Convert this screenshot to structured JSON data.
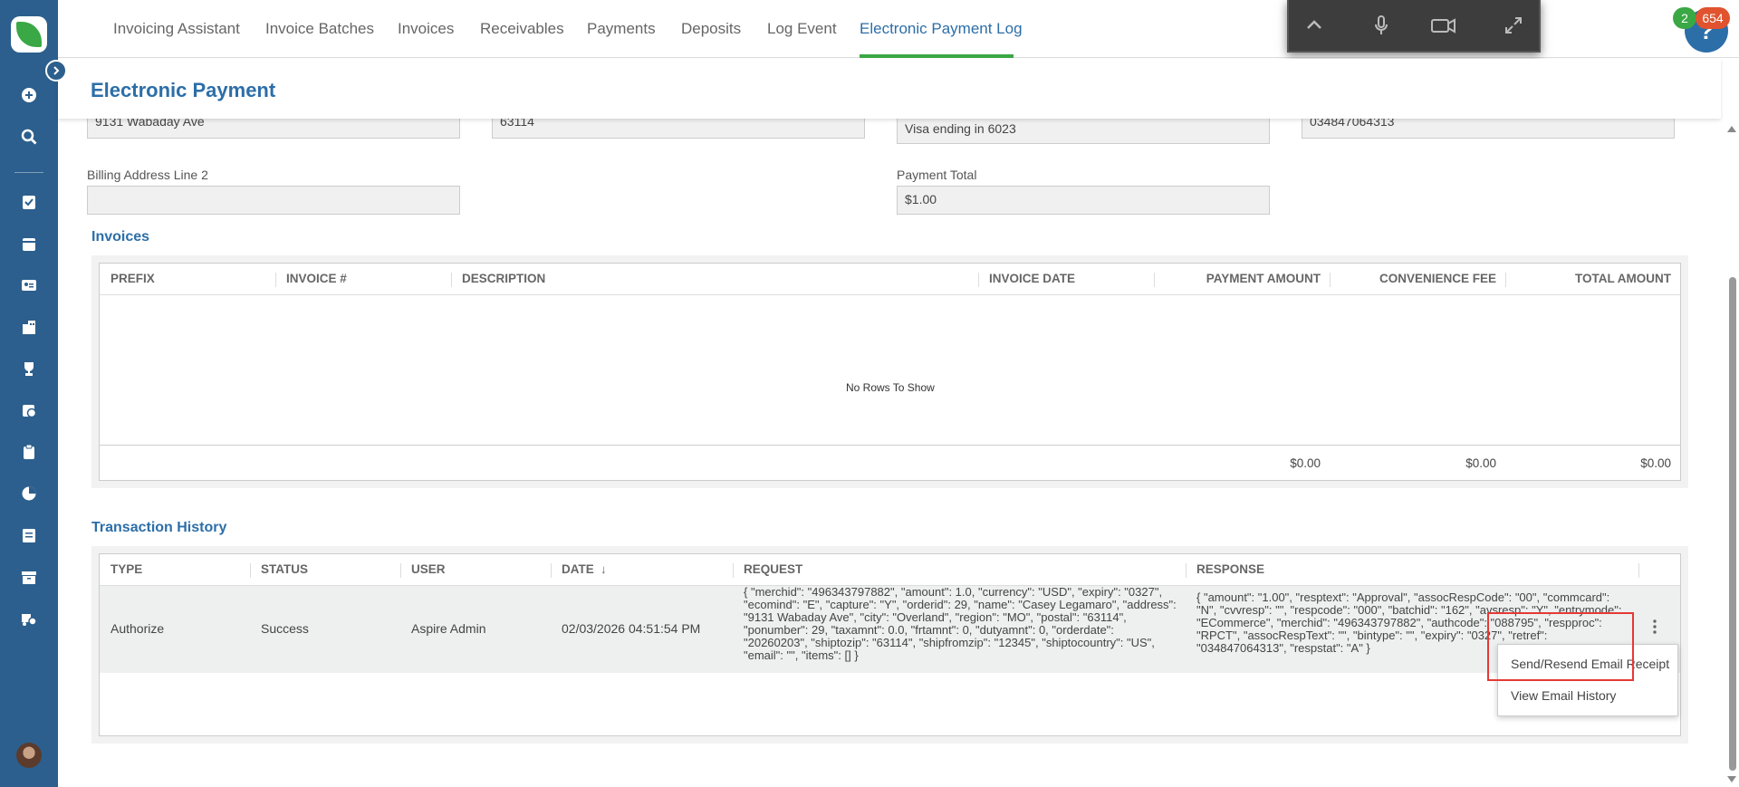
{
  "nav": {
    "items": [
      {
        "label": "Invoicing Assistant"
      },
      {
        "label": "Invoice Batches"
      },
      {
        "label": "Invoices"
      },
      {
        "label": "Receivables"
      },
      {
        "label": "Payments"
      },
      {
        "label": "Deposits"
      },
      {
        "label": "Log Event"
      },
      {
        "label": "Electronic Payment Log"
      }
    ],
    "active_index": 7
  },
  "badges": {
    "green": "2",
    "red": "654"
  },
  "help": {
    "label": "?"
  },
  "header": {
    "title": "Electronic Payment"
  },
  "form": {
    "address_line1": "9131 Wabaday Ave",
    "zip": "63114",
    "card": "Visa ending in 6023",
    "ref": "034847064313",
    "billing_line2_label": "Billing Address Line 2",
    "billing_line2_value": "",
    "payment_total_label": "Payment Total",
    "payment_total_value": "$1.00"
  },
  "invoices": {
    "title": "Invoices",
    "columns": [
      "PREFIX",
      "INVOICE #",
      "DESCRIPTION",
      "INVOICE DATE",
      "PAYMENT AMOUNT",
      "CONVENIENCE FEE",
      "TOTAL AMOUNT"
    ],
    "empty_text": "No Rows To Show",
    "totals": {
      "payment": "$0.00",
      "fee": "$0.00",
      "total": "$0.00"
    }
  },
  "history": {
    "title": "Transaction History",
    "columns": [
      "TYPE",
      "STATUS",
      "USER",
      "DATE",
      "REQUEST",
      "RESPONSE"
    ],
    "sort_indicator": "↓",
    "rows": [
      {
        "type": "Authorize",
        "status": "Success",
        "user": "Aspire Admin",
        "date": "02/03/2026 04:51:54 PM",
        "request": "{ \"merchid\": \"496343797882\", \"amount\": 1.0, \"currency\": \"USD\", \"expiry\": \"0327\", \"ecomind\": \"E\", \"capture\": \"Y\", \"orderid\": 29, \"name\": \"Casey Legamaro\", \"address\": \"9131 Wabaday Ave\", \"city\": \"Overland\", \"region\": \"MO\", \"postal\": \"63114\", \"ponumber\": 29, \"taxamnt\": 0.0, \"frtamnt\": 0, \"dutyamnt\": 0, \"orderdate\": \"20260203\", \"shiptozip\": \"63114\", \"shipfromzip\": \"12345\", \"shiptocountry\": \"US\", \"email\": \"\", \"items\": [] }",
        "response": "{ \"amount\": \"1.00\", \"resptext\": \"Approval\", \"assocRespCode\": \"00\", \"commcard\": \"N\", \"cvvresp\": \"\", \"respcode\": \"000\", \"batchid\": \"162\", \"avsresp\": \"Y\", \"entrymode\": \"ECommerce\", \"merchid\": \"496343797882\", \"authcode\": \"088795\", \"respproc\": \"RPCT\", \"assocRespText\": \"\", \"bintype\": \"\", \"expiry\": \"0327\", \"retref\": \"034847064313\", \"respstat\": \"A\" }"
      }
    ]
  },
  "context_menu": {
    "items": [
      {
        "label": "Send/Resend Email Receipt"
      },
      {
        "label": "View Email History"
      }
    ]
  },
  "colors": {
    "sidebar": "#2c5f8d",
    "accent": "#2c6ea8",
    "active_underline": "#3aa845",
    "highlight": "#e53935"
  }
}
